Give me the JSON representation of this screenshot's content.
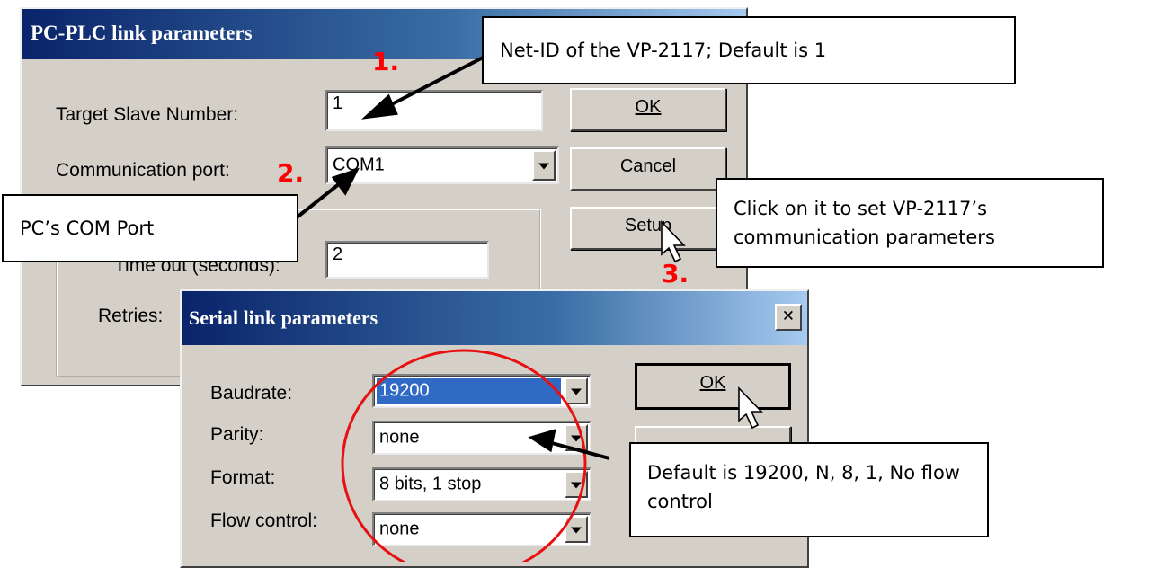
{
  "dialog_main": {
    "title": "PC-PLC link parameters",
    "target_label": "Target Slave Number:",
    "target_value": "1",
    "comm_label": "Communication port:",
    "comm_value": "COM1",
    "timeout_label": "Time out (seconds):",
    "timeout_value": "2",
    "retries_label": "Retries:",
    "ok_label": "OK",
    "cancel_label": "Cancel",
    "setup_label": "Setup"
  },
  "dialog_serial": {
    "title": "Serial link parameters",
    "close_glyph": "×",
    "baud_label": "Baudrate:",
    "baud_value": "19200",
    "parity_label": "Parity:",
    "parity_value": "none",
    "format_label": "Format:",
    "format_value": "8 bits, 1 stop",
    "flow_label": "Flow control:",
    "flow_value": "none",
    "ok_label": "OK"
  },
  "annotations": {
    "step1": "1.",
    "step2": "2.",
    "step3": "3.",
    "callout_netid": "Net-ID of the VP-2117; Default is 1",
    "callout_com": "PC’s COM Port",
    "callout_setup": "Click on it to set VP-2117’s communication parameters",
    "callout_default": "Default is 19200, N, 8, 1, No flow control"
  },
  "colors": {
    "title_bar": "#0a246a",
    "dialog_face": "#d4d0c8",
    "step_red": "#ff0000",
    "selection": "#316ac5"
  }
}
